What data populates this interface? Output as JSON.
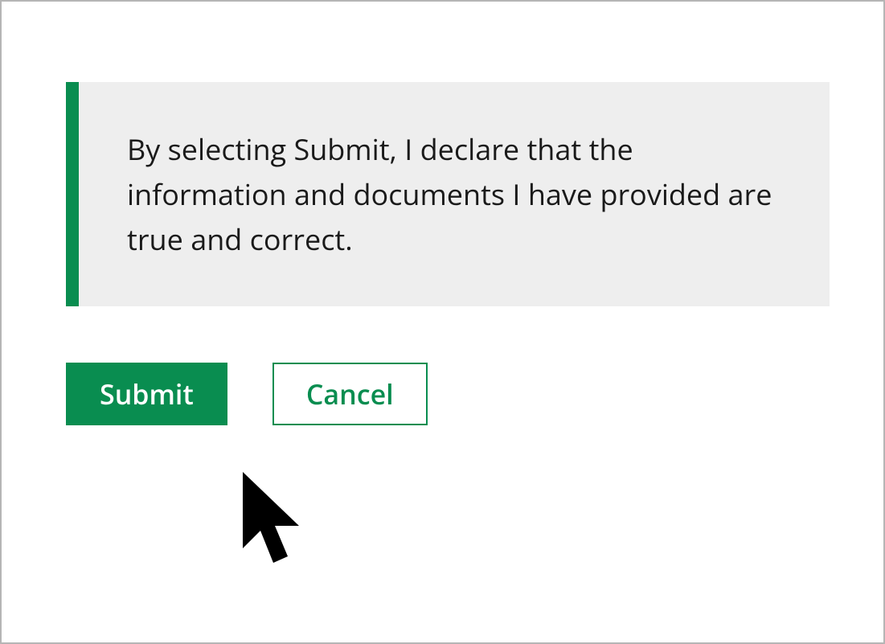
{
  "declaration": {
    "text": "By selecting Submit, I declare that the information and documents I have provided are true and correct."
  },
  "buttons": {
    "submit_label": "Submit",
    "cancel_label": "Cancel"
  },
  "colors": {
    "accent": "#098d50",
    "panel_bg": "#eeeeee",
    "frame_border": "#b5b5b5"
  }
}
